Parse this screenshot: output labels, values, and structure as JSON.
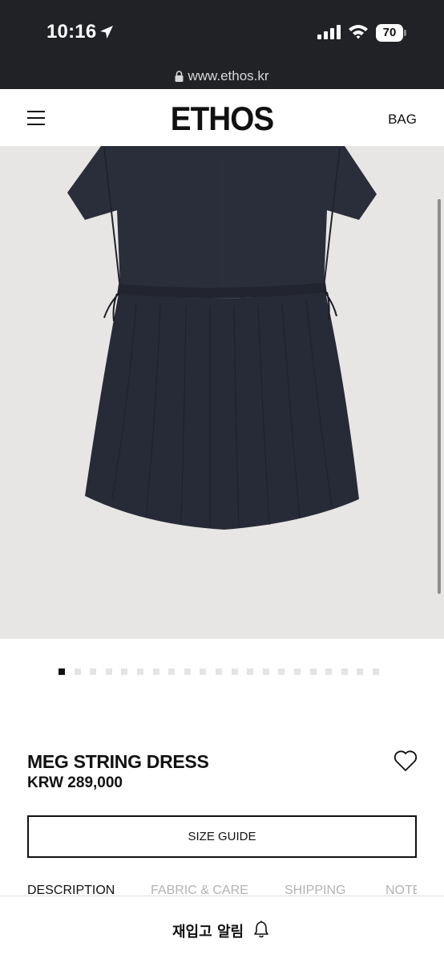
{
  "status_bar": {
    "time": "10:16",
    "battery": "70"
  },
  "browser": {
    "url": "www.ethos.kr"
  },
  "header": {
    "logo": "ETHOS",
    "bag_label": "BAG"
  },
  "gallery": {
    "image_alt": "MEG STRING DRESS",
    "slide_count": 21,
    "active_slide": 1
  },
  "product": {
    "name": "MEG STRING DRESS",
    "price": "KRW 289,000"
  },
  "buttons": {
    "size_guide": "SIZE GUIDE"
  },
  "tabs": [
    {
      "label": "DESCRIPTION",
      "active": true
    },
    {
      "label": "FABRIC & CARE",
      "active": false
    },
    {
      "label": "SHIPPING",
      "active": false
    },
    {
      "label": "NOTE",
      "active": false
    }
  ],
  "restock": {
    "label": "재입고 알림"
  },
  "icons": [
    "location-arrow-icon",
    "signal-icon",
    "wifi-icon",
    "battery-icon",
    "lock-icon",
    "menu-icon",
    "heart-icon",
    "bell-icon"
  ],
  "colors": {
    "status_bar_bg": "#202225",
    "image_bg": "#e8e6e4",
    "dress": "#262a36",
    "text": "#111111",
    "inactive_tab": "#b3b3b3"
  }
}
